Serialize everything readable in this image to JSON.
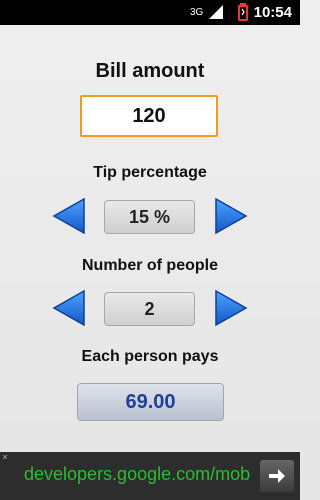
{
  "status_bar": {
    "network": "3G",
    "time": "10:54"
  },
  "bill": {
    "label": "Bill amount",
    "value": "120"
  },
  "tip": {
    "label": "Tip percentage",
    "value": "15 %"
  },
  "people": {
    "label": "Number of people",
    "value": "2"
  },
  "result": {
    "label": "Each person pays",
    "value": "69.00"
  },
  "ad": {
    "text": "developers.google.com/mob",
    "close_glyph": "×",
    "button_icon": "right-arrow-icon"
  },
  "colors": {
    "accent_orange": "#f39a24",
    "arrow_blue": "#1d63d6",
    "result_text": "#1f3f9a",
    "ad_text": "#2bbd31"
  }
}
